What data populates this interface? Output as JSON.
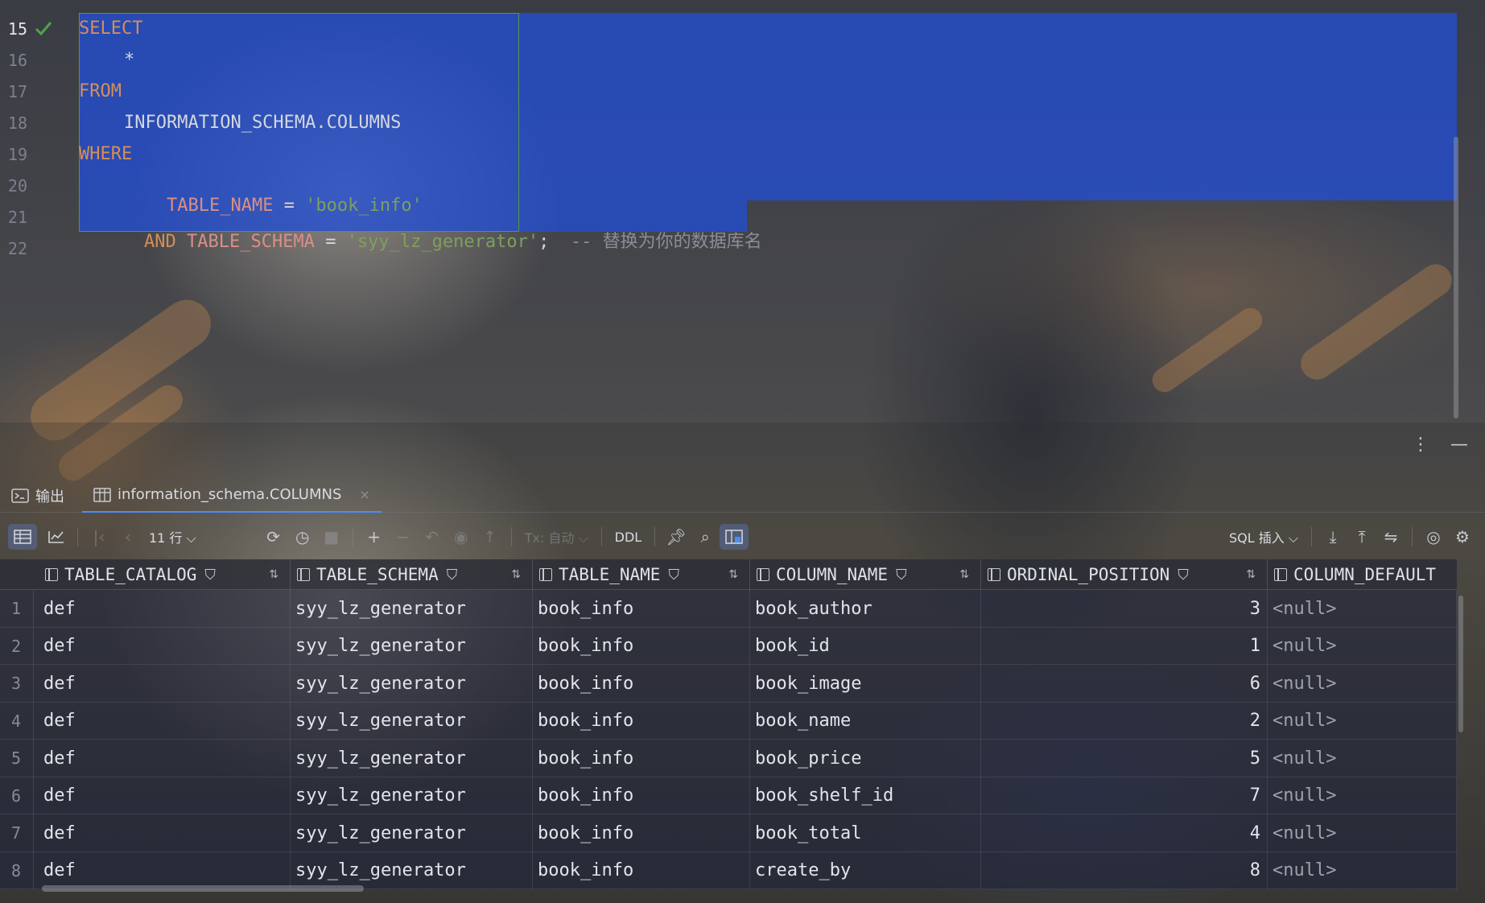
{
  "editor": {
    "lines": [
      {
        "num": "15",
        "active": true
      },
      {
        "num": "16"
      },
      {
        "num": "17"
      },
      {
        "num": "18"
      },
      {
        "num": "19"
      },
      {
        "num": "20"
      },
      {
        "num": "21"
      },
      {
        "num": "22"
      }
    ],
    "code": {
      "select": "SELECT",
      "star": "*",
      "from": "FROM",
      "table": "INFORMATION_SCHEMA.COLUMNS",
      "where": "WHERE",
      "col_table_name": "TABLE_NAME",
      "eq": "=",
      "val_table_name": "'book_info'",
      "and": "AND",
      "col_table_schema": "TABLE_SCHEMA",
      "val_table_schema": "'syy_lz_generator'",
      "semi": ";",
      "comment": "-- 替换为你的数据库名"
    }
  },
  "panel": {
    "tabs": [
      {
        "label": "输出",
        "icon": "terminal-icon"
      },
      {
        "label": "information_schema.COLUMNS",
        "icon": "table-icon",
        "close": "×"
      }
    ],
    "toolbar": {
      "row_count": "11 行",
      "tx_mode": "Tx: 自动",
      "ddl": "DDL",
      "sql_insert": "SQL 插入"
    }
  },
  "grid": {
    "columns": [
      "TABLE_CATALOG",
      "TABLE_SCHEMA",
      "TABLE_NAME",
      "COLUMN_NAME",
      "ORDINAL_POSITION",
      "COLUMN_DEFAULT"
    ],
    "rows": [
      {
        "n": "1",
        "c": [
          "def",
          "syy_lz_generator",
          "book_info",
          "book_author",
          "3",
          "<null>"
        ]
      },
      {
        "n": "2",
        "c": [
          "def",
          "syy_lz_generator",
          "book_info",
          "book_id",
          "1",
          "<null>"
        ]
      },
      {
        "n": "3",
        "c": [
          "def",
          "syy_lz_generator",
          "book_info",
          "book_image",
          "6",
          "<null>"
        ]
      },
      {
        "n": "4",
        "c": [
          "def",
          "syy_lz_generator",
          "book_info",
          "book_name",
          "2",
          "<null>"
        ]
      },
      {
        "n": "5",
        "c": [
          "def",
          "syy_lz_generator",
          "book_info",
          "book_price",
          "5",
          "<null>"
        ]
      },
      {
        "n": "6",
        "c": [
          "def",
          "syy_lz_generator",
          "book_info",
          "book_shelf_id",
          "7",
          "<null>"
        ]
      },
      {
        "n": "7",
        "c": [
          "def",
          "syy_lz_generator",
          "book_info",
          "book_total",
          "4",
          "<null>"
        ]
      },
      {
        "n": "8",
        "c": [
          "def",
          "syy_lz_generator",
          "book_info",
          "create_by",
          "8",
          "<null>"
        ]
      }
    ]
  },
  "colors": {
    "selection": "#2348d2",
    "keyword": "#d58e57",
    "string": "#7ea05a",
    "statement_border": "#4f9a4a",
    "success_check": "#4fa34a"
  }
}
